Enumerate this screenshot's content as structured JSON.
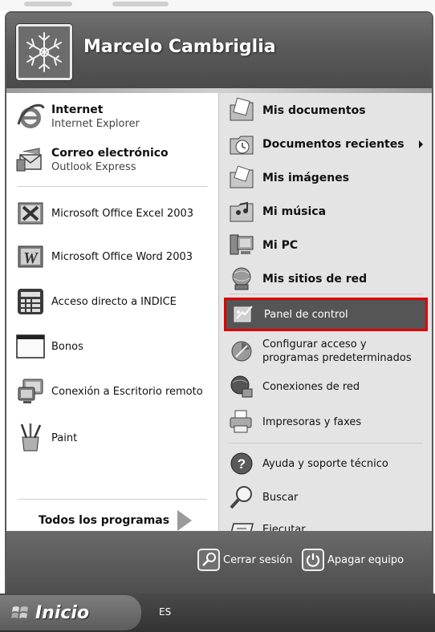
{
  "user": {
    "name": "Marcelo Cambriglia",
    "avatar_icon": "snowflake-icon"
  },
  "left_panel": {
    "pinned": [
      {
        "title": "Internet",
        "subtitle": "Internet Explorer",
        "icon": "internet-explorer-icon"
      },
      {
        "title": "Correo electrónico",
        "subtitle": "Outlook Express",
        "icon": "outlook-express-icon"
      }
    ],
    "recent": [
      {
        "label": "Microsoft Office Excel 2003",
        "icon": "excel-icon"
      },
      {
        "label": "Microsoft Office Word 2003",
        "icon": "word-icon"
      },
      {
        "label": "Acceso directo a INDICE",
        "icon": "calculator-icon"
      },
      {
        "label": "Bonos",
        "icon": "window-icon"
      },
      {
        "label": "Conexión a Escritorio remoto",
        "icon": "remote-desktop-icon"
      },
      {
        "label": "Paint",
        "icon": "paint-icon"
      }
    ],
    "all_programs": "Todos los programas"
  },
  "right_panel": {
    "places": [
      {
        "label": "Mis documentos",
        "icon": "documents-folder-icon"
      },
      {
        "label": "Documentos recientes",
        "icon": "recent-documents-icon",
        "has_submenu": true
      },
      {
        "label": "Mis imágenes",
        "icon": "pictures-folder-icon"
      },
      {
        "label": "Mi música",
        "icon": "music-folder-icon"
      },
      {
        "label": "Mi PC",
        "icon": "my-computer-icon"
      },
      {
        "label": "Mis sitios de red",
        "icon": "network-places-icon"
      }
    ],
    "control_panel": {
      "label": "Panel de control",
      "icon": "control-panel-icon",
      "highlighted": true
    },
    "config": {
      "line1": "Configurar acceso y",
      "line2": "programas predeterminados",
      "icon": "program-access-icon"
    },
    "network_connections": {
      "label": "Conexiones de red",
      "icon": "network-connections-icon"
    },
    "printers": {
      "label": "Impresoras y faxes",
      "icon": "printer-icon"
    },
    "help": {
      "label": "Ayuda y soporte técnico",
      "icon": "help-icon"
    },
    "search": {
      "label": "Buscar",
      "icon": "search-icon"
    },
    "run": {
      "label": "Ejecutar...",
      "icon": "run-icon"
    }
  },
  "footer": {
    "logoff": {
      "label": "Cerrar sesión",
      "icon": "key-icon"
    },
    "shutdown": {
      "label": "Apagar equipo",
      "icon": "power-icon"
    }
  },
  "taskbar": {
    "start_label": "Inicio",
    "language": "ES"
  },
  "colors": {
    "highlight_border": "#e00000",
    "selected_bg": "#555555"
  }
}
